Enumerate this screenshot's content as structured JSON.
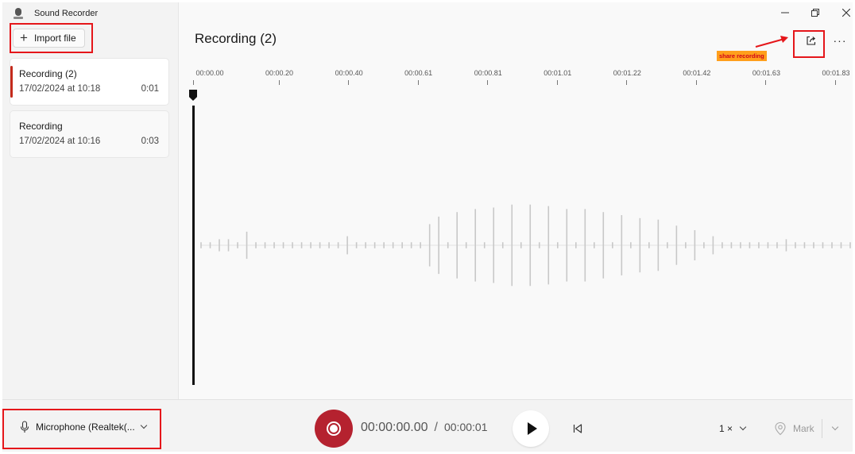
{
  "app": {
    "title": "Sound Recorder"
  },
  "sidebar": {
    "import_label": "Import file",
    "recordings": [
      {
        "name": "Recording (2)",
        "date": "17/02/2024 at 10:18",
        "duration": "0:01",
        "selected": true
      },
      {
        "name": "Recording",
        "date": "17/02/2024 at 10:16",
        "duration": "0:03",
        "selected": false
      }
    ]
  },
  "main": {
    "title": "Recording (2)",
    "share_annotation": "share recording",
    "timeline_ticks": [
      "00:00.00",
      "00:00.20",
      "00:00.40",
      "00:00.61",
      "00:00.81",
      "00:01.01",
      "00:01.22",
      "00:01.42",
      "00:01.63",
      "00:01.83"
    ]
  },
  "waveform": {
    "bars": [
      0.2,
      0.2,
      0.4,
      0.4,
      0.2,
      0.9,
      0.2,
      0.2,
      0.2,
      0.2,
      0.2,
      0.2,
      0.2,
      0.2,
      0.2,
      0.2,
      0.6,
      0.2,
      0.2,
      0.2,
      0.2,
      0.2,
      0.2,
      0.2,
      0.2,
      1.4,
      1.9,
      0.2,
      2.2,
      0.2,
      2.4,
      0.2,
      2.5,
      0.2,
      2.7,
      0.2,
      2.7,
      0.2,
      2.6,
      0.2,
      2.4,
      0.2,
      2.4,
      0.2,
      2.2,
      0.2,
      2.0,
      0.2,
      1.8,
      0.2,
      1.7,
      0.2,
      1.3,
      0.2,
      1.0,
      0.2,
      0.6,
      0.2,
      0.2,
      0.2,
      0.2,
      0.2,
      0.2,
      0.2,
      0.4,
      0.2,
      0.2,
      0.2,
      0.2,
      0.2,
      0.2,
      0.2
    ],
    "color": "#c8c8c8",
    "axis_color": "#e3e3e3"
  },
  "bottom": {
    "microphone": "Microphone (Realtek(...",
    "time_current": "00:00:00.00",
    "time_separator": "/",
    "time_total": "00:00:01",
    "speed": "1 ×",
    "mark_label": "Mark"
  },
  "colors": {
    "accent": "#c42b1c",
    "record_button": "#b5222f",
    "annotation_box": "#e5161a",
    "annotation_tag_bg": "#ff9f1c"
  },
  "icons": {
    "app": "microphone-icon",
    "import": "plus-icon",
    "share": "share-icon",
    "more": "more-options-icon",
    "mic": "microphone-icon",
    "record": "record-icon",
    "play": "play-icon",
    "skip": "skip-to-start-icon",
    "mark": "location-pin-icon"
  }
}
